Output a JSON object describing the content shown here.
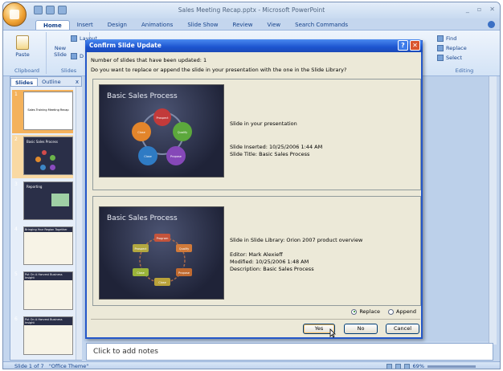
{
  "window": {
    "title": "Sales Meeting Recap.pptx - Microsoft PowerPoint"
  },
  "ribbon": {
    "tabs": [
      "Home",
      "Insert",
      "Design",
      "Animations",
      "Slide Show",
      "Review",
      "View",
      "Search Commands"
    ],
    "groups": {
      "clipboard": "Clipboard",
      "slides": "Slides",
      "editing": "Editing"
    },
    "buttons": {
      "paste": "Paste",
      "new_slide": "New Slide",
      "layout": "Layout",
      "delete": "D",
      "find": "Find",
      "replace": "Replace",
      "select": "Select"
    }
  },
  "pane": {
    "tabs": [
      "Slides",
      "Outline"
    ],
    "thumbnails": [
      {
        "num": "1",
        "title": "Sales Training Meeting Recap"
      },
      {
        "num": "2",
        "title": "Basic Sales Process"
      },
      {
        "num": "3",
        "title": "Reporting"
      },
      {
        "num": "4",
        "title": "Bringing Your Region Together"
      },
      {
        "num": "5",
        "title": "Put On A Harvest Business Insight"
      },
      {
        "num": "6",
        "title": "Put On A Harvest Business Insight"
      }
    ]
  },
  "notes": {
    "placeholder": "Click to add notes"
  },
  "status": {
    "slide": "Slide 1 of 7",
    "theme": "\"Office Theme\"",
    "zoom": "69%"
  },
  "dialog": {
    "title": "Confirm Slide Update",
    "count_label": "Number of slides that have been updated: 1",
    "question": "Do you want to replace or append the slide in your presentation with the one in the Slide Library?",
    "current": {
      "thumb_title": "Basic Sales Process",
      "heading": "Slide in your presentation",
      "inserted": "Slide Inserted: 10/25/2006 1:44 AM",
      "slide_title": "Slide Title: Basic Sales Process"
    },
    "library": {
      "thumb_title": "Basic Sales Process",
      "heading": "Slide in Slide Library: Orion 2007 product overview",
      "editor": "Editor: Mark Alexieff",
      "modified": "Modified: 10/25/2006 1:48 AM",
      "description": "Description: Basic Sales Process"
    },
    "options": {
      "replace": "Replace",
      "append": "Append",
      "selected": "replace"
    },
    "buttons": {
      "yes": "Yes",
      "no": "No",
      "cancel": "Cancel"
    },
    "process_labels_1": [
      "Prospect",
      "Qualify",
      "Propose",
      "Close",
      "Close"
    ],
    "process_labels_2": [
      "Program",
      "Qualify",
      "Propose",
      "Close",
      "Close",
      "Prospect"
    ]
  },
  "colors": {
    "accent": "#1d55d0",
    "ribbon": "#d3e3f6",
    "selected_thumb": "#f4b25c"
  }
}
